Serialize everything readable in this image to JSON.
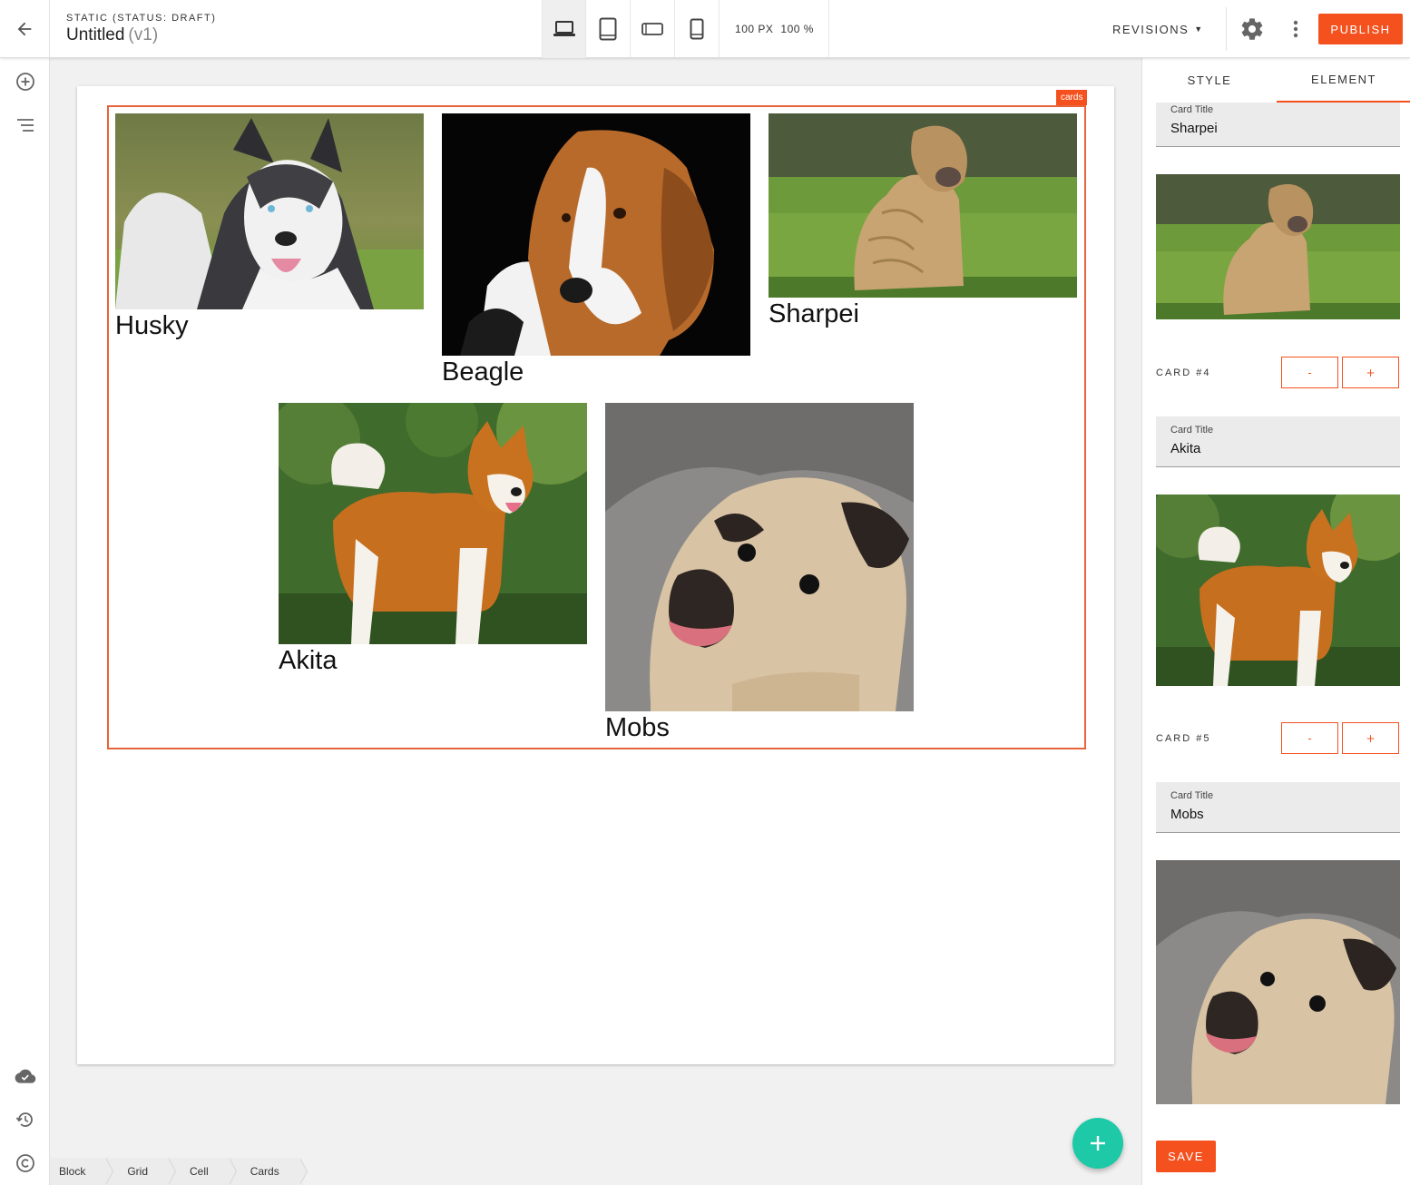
{
  "header": {
    "status": "STATIC (STATUS: DRAFT)",
    "title": "Untitled",
    "version": "(v1)",
    "zoom_px": "100 PX",
    "zoom_pct": "100 %",
    "revisions": "REVISIONS",
    "publish": "PUBLISH"
  },
  "canvas": {
    "selection_tag": "cards",
    "cards": [
      {
        "title": "Husky",
        "image": "husky"
      },
      {
        "title": "Beagle",
        "image": "beagle"
      },
      {
        "title": "Sharpei",
        "image": "sharpei"
      },
      {
        "title": "Akita",
        "image": "akita"
      },
      {
        "title": "Mobs",
        "image": "pug"
      }
    ]
  },
  "breadcrumb": [
    "Block",
    "Grid",
    "Cell",
    "Cards"
  ],
  "panel": {
    "tabs": [
      "STYLE",
      "ELEMENT"
    ],
    "active_tab": "ELEMENT",
    "field_label": "Card Title",
    "card3_title": "Sharpei",
    "card4_label": "CARD #4",
    "card4_title": "Akita",
    "card5_label": "CARD #5",
    "card5_title": "Mobs",
    "minus": "-",
    "plus": "+",
    "save": "SAVE"
  },
  "colors": {
    "accent": "#f4511e",
    "fab": "#1dc9a6"
  }
}
